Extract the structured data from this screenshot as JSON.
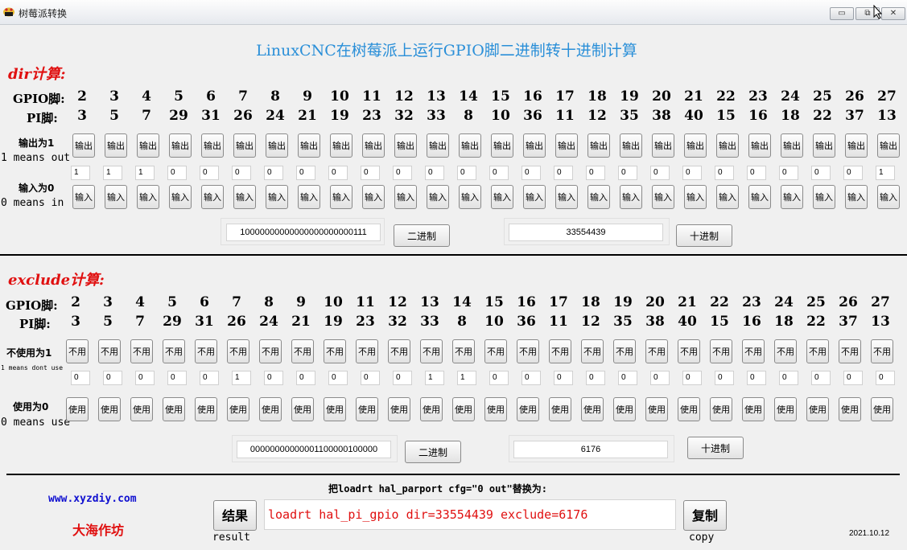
{
  "window": {
    "title": "树莓派转换",
    "minimize": "▭",
    "restore": "⧉",
    "close": "✕"
  },
  "main_title": "LinuxCNC在树莓派上运行GPIO脚二进制转十进制计算",
  "dir": {
    "title": "dir计算:",
    "gpio_label": "GPIO脚:",
    "pi_label": "PI脚:",
    "gpio": [
      "2",
      "3",
      "4",
      "5",
      "6",
      "7",
      "8",
      "9",
      "10",
      "11",
      "12",
      "13",
      "14",
      "15",
      "16",
      "17",
      "18",
      "19",
      "20",
      "21",
      "22",
      "23",
      "24",
      "25",
      "26",
      "27"
    ],
    "pi": [
      "3",
      "5",
      "7",
      "29",
      "31",
      "26",
      "24",
      "21",
      "19",
      "23",
      "32",
      "33",
      "8",
      "10",
      "36",
      "11",
      "12",
      "35",
      "38",
      "40",
      "15",
      "16",
      "18",
      "22",
      "37",
      "13"
    ],
    "row1_label": "输出为1",
    "row1_sub": "1 means out",
    "row1_button": "输出",
    "row2_label": "输入为0",
    "row2_sub": "0 means in",
    "row2_button": "输入",
    "values": [
      "1",
      "1",
      "1",
      "0",
      "0",
      "0",
      "0",
      "0",
      "0",
      "0",
      "0",
      "0",
      "0",
      "0",
      "0",
      "0",
      "0",
      "0",
      "0",
      "0",
      "0",
      "0",
      "0",
      "0",
      "0",
      "1"
    ],
    "binary": "10000000000000000000000111",
    "binary_button": "二进制",
    "decimal": "33554439",
    "decimal_button": "十进制"
  },
  "exclude": {
    "title": "exclude计算:",
    "gpio_label": "GPIO脚:",
    "pi_label": "PI脚:",
    "gpio": [
      "2",
      "3",
      "4",
      "5",
      "6",
      "7",
      "8",
      "9",
      "10",
      "11",
      "12",
      "13",
      "14",
      "15",
      "16",
      "17",
      "18",
      "19",
      "20",
      "21",
      "22",
      "23",
      "24",
      "25",
      "26",
      "27"
    ],
    "pi": [
      "3",
      "5",
      "7",
      "29",
      "31",
      "26",
      "24",
      "21",
      "19",
      "23",
      "32",
      "33",
      "8",
      "10",
      "36",
      "11",
      "12",
      "35",
      "38",
      "40",
      "15",
      "16",
      "18",
      "22",
      "37",
      "13"
    ],
    "row1_label": "不使用为1",
    "row1_sub": "1 means dont use",
    "row1_button": "不用",
    "row2_label": "使用为0",
    "row2_sub": "0 means use",
    "row2_button": "使用",
    "values": [
      "0",
      "0",
      "0",
      "0",
      "0",
      "1",
      "0",
      "0",
      "0",
      "0",
      "0",
      "1",
      "1",
      "0",
      "0",
      "0",
      "0",
      "0",
      "0",
      "0",
      "0",
      "0",
      "0",
      "0",
      "0",
      "0"
    ],
    "binary": "00000000000001100000100000",
    "binary_button": "二进制",
    "decimal": "6176",
    "decimal_button": "十进制"
  },
  "footer": {
    "site": "www.xyzdiy.com",
    "author": "大海作坊",
    "prompt": "把loadrt hal_parport cfg=\"0 out\"替换为:",
    "result_button": "结果",
    "result_sub": "result",
    "output": "loadrt hal_pi_gpio dir=33554439 exclude=6176",
    "copy_button": "复制",
    "copy_sub": "copy",
    "date": "2021.10.12"
  },
  "colors": {
    "title_blue": "#2a8fd8",
    "accent_red": "#e01010",
    "link_blue": "#1010d0"
  }
}
